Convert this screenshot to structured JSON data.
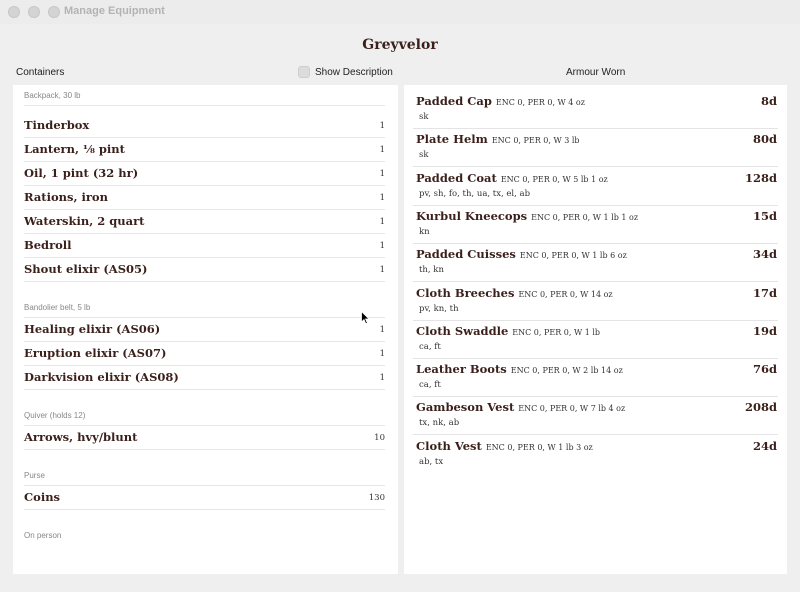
{
  "window": {
    "title": "Manage Equipment"
  },
  "character": {
    "name": "Greyvelor"
  },
  "headers": {
    "containers": "Containers",
    "show_description": "Show Description",
    "armour_worn": "Armour Worn"
  },
  "containers": [
    {
      "title": "Backpack, 30 lb",
      "items": [
        {
          "name": "Tinderbox",
          "qty": "1"
        },
        {
          "name": "Lantern, ⅛ pint",
          "qty": "1"
        },
        {
          "name": "Oil, 1 pint (32 hr)",
          "qty": "1"
        },
        {
          "name": "Rations, iron",
          "qty": "1"
        },
        {
          "name": "Waterskin, 2 quart",
          "qty": "1"
        },
        {
          "name": "Bedroll",
          "qty": "1"
        },
        {
          "name": "Shout elixir (AS05)",
          "qty": "1"
        }
      ]
    },
    {
      "title": "Bandolier belt, 5 lb",
      "items": [
        {
          "name": "Healing elixir (AS06)",
          "qty": "1"
        },
        {
          "name": "Eruption elixir (AS07)",
          "qty": "1"
        },
        {
          "name": "Darkvision elixir (AS08)",
          "qty": "1"
        }
      ]
    },
    {
      "title": "Quiver (holds 12)",
      "items": [
        {
          "name": "Arrows, hvy/blunt",
          "qty": "10"
        }
      ]
    },
    {
      "title": "Purse",
      "items": [
        {
          "name": "Coins",
          "qty": "130"
        }
      ]
    },
    {
      "title": "On person",
      "items": []
    }
  ],
  "armour": [
    {
      "name": "Padded Cap",
      "stats": "ENC 0, PER 0, W 4 oz",
      "locations": "sk",
      "cost": "8d"
    },
    {
      "name": "Plate Helm",
      "stats": "ENC 0, PER 0, W 3 lb",
      "locations": "sk",
      "cost": "80d"
    },
    {
      "name": "Padded Coat",
      "stats": "ENC 0, PER 0, W 5 lb 1 oz",
      "locations": "pv, sh, fo, th, ua, tx, el, ab",
      "cost": "128d"
    },
    {
      "name": "Kurbul Kneecops",
      "stats": "ENC 0, PER 0, W 1 lb 1 oz",
      "locations": "kn",
      "cost": "15d"
    },
    {
      "name": "Padded Cuisses",
      "stats": "ENC 0, PER 0, W 1 lb 6 oz",
      "locations": "th, kn",
      "cost": "34d"
    },
    {
      "name": "Cloth Breeches",
      "stats": "ENC 0, PER 0, W 14 oz",
      "locations": "pv, kn, th",
      "cost": "17d"
    },
    {
      "name": "Cloth Swaddle",
      "stats": "ENC 0, PER 0, W 1 lb",
      "locations": "ca, ft",
      "cost": "19d"
    },
    {
      "name": "Leather Boots",
      "stats": "ENC 0, PER 0, W 2 lb 14 oz",
      "locations": "ca, ft",
      "cost": "76d"
    },
    {
      "name": "Gambeson Vest",
      "stats": "ENC 0, PER 0, W 7 lb 4 oz",
      "locations": "tx, nk, ab",
      "cost": "208d"
    },
    {
      "name": "Cloth Vest",
      "stats": "ENC 0, PER 0, W 1 lb 3 oz",
      "locations": "ab, tx",
      "cost": "24d"
    }
  ]
}
